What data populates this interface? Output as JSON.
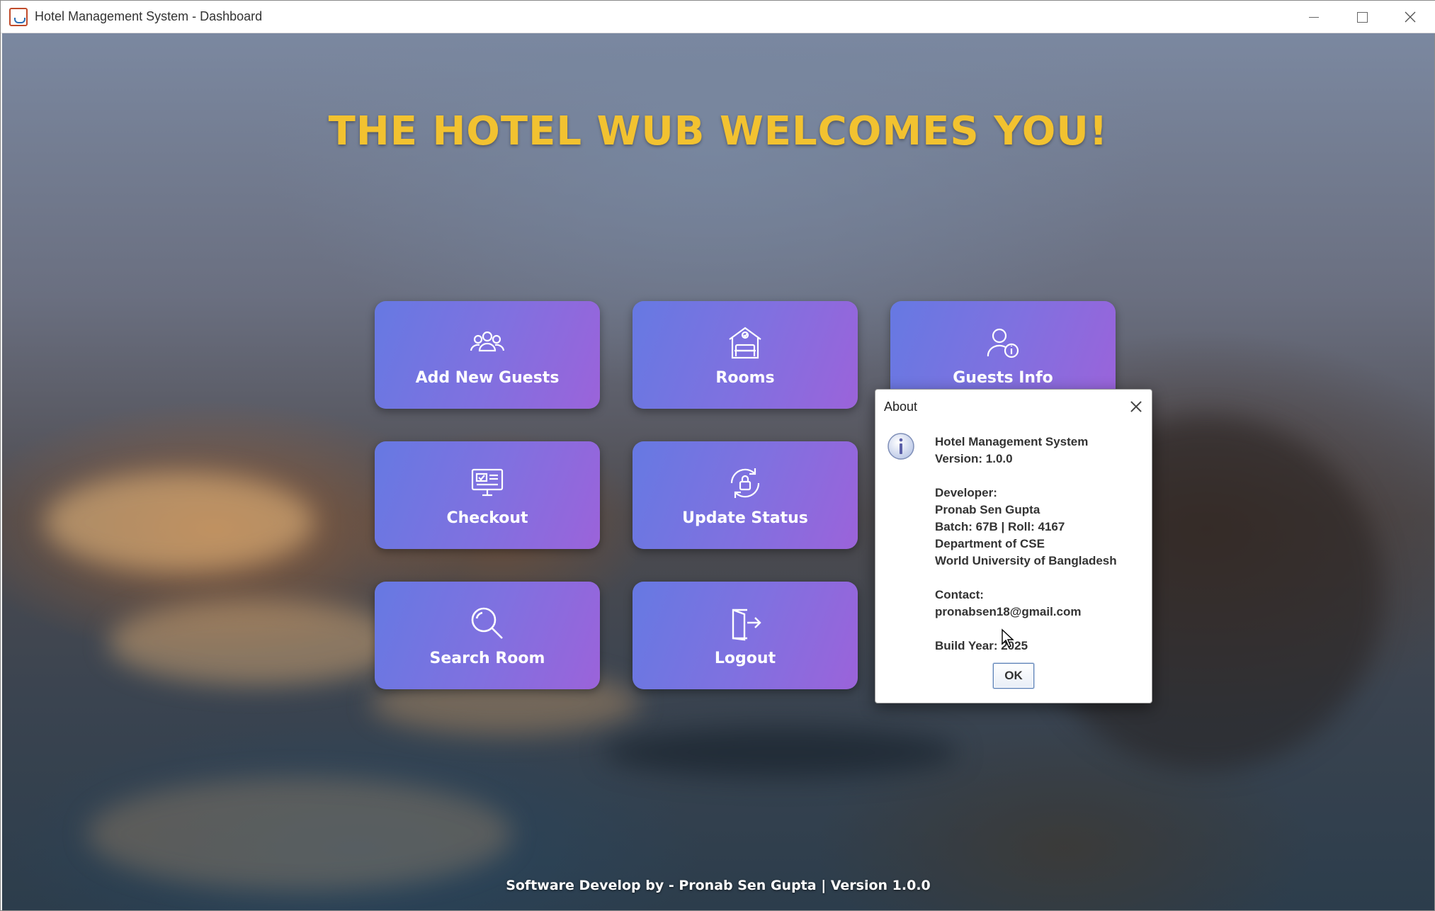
{
  "window": {
    "title": "Hotel Management System - Dashboard"
  },
  "dashboard": {
    "heading": "THE HOTEL WUB WELCOMES YOU!",
    "heading_color": "#f2c230",
    "tiles": [
      {
        "label": "Add New Guests",
        "icon": "users-icon"
      },
      {
        "label": "Rooms",
        "icon": "bed-icon"
      },
      {
        "label": "Guests Info",
        "icon": "user-info-icon"
      },
      {
        "label": "Checkout",
        "icon": "checkout-icon"
      },
      {
        "label": "Update Status",
        "icon": "refresh-lock-icon"
      },
      {
        "label": "Search Room",
        "icon": "search-icon"
      },
      {
        "label": "Logout",
        "icon": "logout-icon"
      }
    ],
    "tile_gradient": [
      "#6679e2",
      "#9b63da"
    ],
    "footer": "Software Develop by - Pronab Sen Gupta | Version 1.0.0"
  },
  "about_dialog": {
    "title": "About",
    "icon": "info-icon",
    "lines": [
      "Hotel Management System",
      "Version: 1.0.0",
      "",
      "Developer:",
      "Pronab Sen Gupta",
      "Batch: 67B | Roll: 4167",
      "Department of CSE",
      "World University of Bangladesh",
      "",
      "Contact:",
      "pronabsen18@gmail.com",
      "",
      "Build Year: 2025"
    ],
    "ok_label": "OK"
  }
}
